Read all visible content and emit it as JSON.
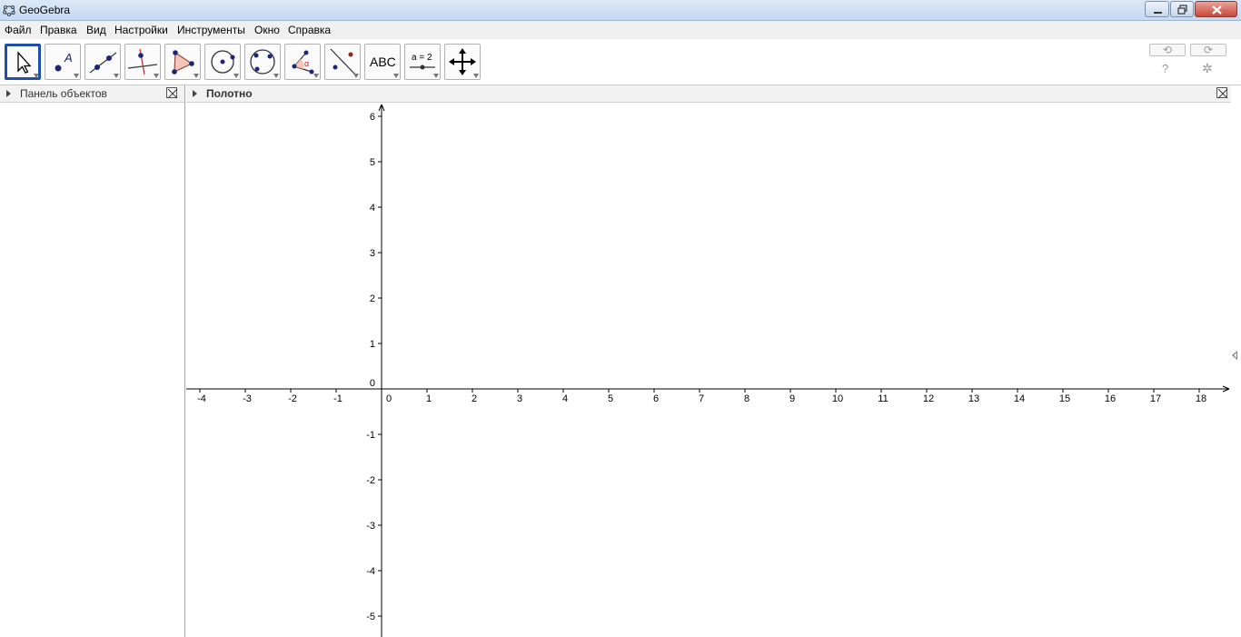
{
  "window": {
    "title": "GeoGebra"
  },
  "menu": [
    "Файл",
    "Правка",
    "Вид",
    "Настройки",
    "Инструменты",
    "Окно",
    "Справка"
  ],
  "toolbar": {
    "tools": [
      {
        "name": "move-tool",
        "icon": "cursor-arrow-icon",
        "selected": true
      },
      {
        "name": "point-tool",
        "icon": "point-icon"
      },
      {
        "name": "line-tool",
        "icon": "line-through-points-icon"
      },
      {
        "name": "perpendicular-tool",
        "icon": "perpendicular-line-icon"
      },
      {
        "name": "polygon-tool",
        "icon": "polygon-icon"
      },
      {
        "name": "circle-tool",
        "icon": "circle-center-point-icon"
      },
      {
        "name": "circle-3pt-tool",
        "icon": "circle-three-points-icon"
      },
      {
        "name": "angle-tool",
        "icon": "angle-icon",
        "label": "α"
      },
      {
        "name": "reflect-tool",
        "icon": "reflect-about-line-icon"
      },
      {
        "name": "text-tool",
        "icon": "text-icon",
        "label": "ABC"
      },
      {
        "name": "slider-tool",
        "icon": "slider-icon",
        "label": "a = 2"
      },
      {
        "name": "move-graphics-tool",
        "icon": "move-graphics-view-icon"
      }
    ],
    "undo": "⟲",
    "redo": "⟳",
    "help": "?",
    "settings": "✲"
  },
  "algebra_panel": {
    "title": "Панель объектов"
  },
  "graphics_panel": {
    "title": "Полотно"
  },
  "axes": {
    "x_ticks": [
      "-4",
      "-3",
      "-2",
      "-1",
      "0",
      "1",
      "2",
      "3",
      "4",
      "5",
      "6",
      "7",
      "8",
      "9",
      "10",
      "11",
      "12",
      "13",
      "14",
      "15",
      "16",
      "17",
      "18"
    ],
    "y_ticks": [
      "6",
      "5",
      "4",
      "3",
      "2",
      "1",
      "0",
      "-1",
      "-2",
      "-3",
      "-4",
      "-5"
    ]
  },
  "colors": {
    "selected_tool_border": "#1f4fa8",
    "point": "#1a237e",
    "accent_red": "#c62828"
  }
}
